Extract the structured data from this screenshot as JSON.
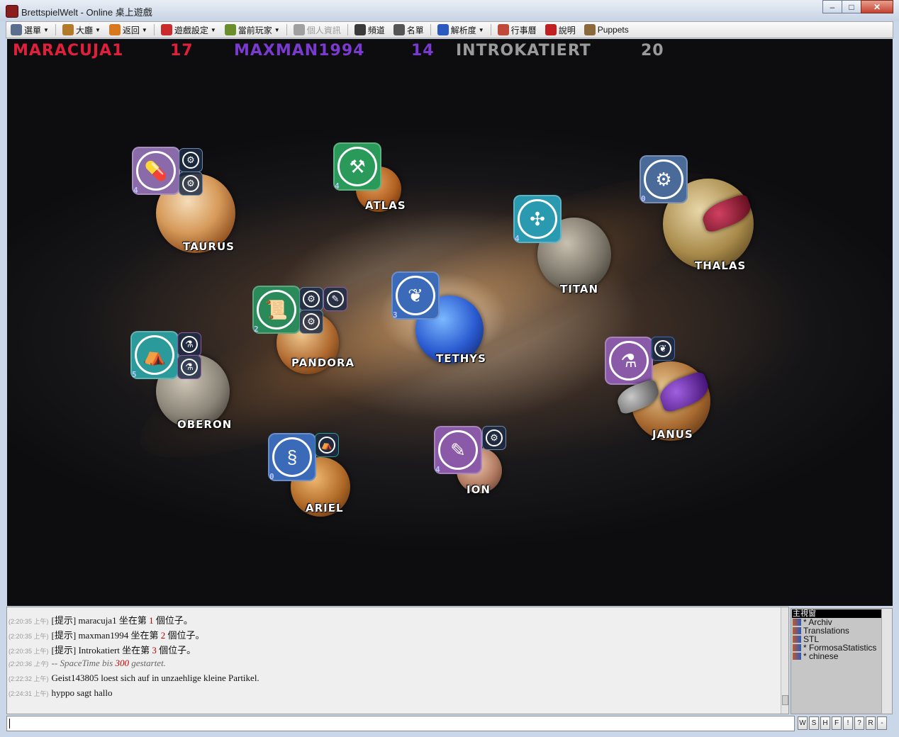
{
  "window": {
    "title": "BrettspielWelt - Online 桌上遊戲",
    "min": "–",
    "max": "□",
    "close": "✕"
  },
  "toolbar": [
    {
      "id": "menu",
      "label": "選單",
      "dropdown": true,
      "icon": "menu-icon",
      "color": "#5a6f8e"
    },
    {
      "id": "lobby",
      "label": "大廳",
      "dropdown": true,
      "icon": "lobby-icon",
      "color": "#b27a2a"
    },
    {
      "id": "back",
      "label": "返回",
      "dropdown": true,
      "icon": "back-icon",
      "color": "#d6791f"
    },
    {
      "id": "game-settings",
      "label": "遊戲設定",
      "dropdown": true,
      "icon": "settings-icon",
      "color": "#c92a2a"
    },
    {
      "id": "current-players",
      "label": "當前玩家",
      "dropdown": true,
      "icon": "players-icon",
      "color": "#6a8f2a"
    },
    {
      "id": "personal-info",
      "label": "個人資訊",
      "dropdown": false,
      "disabled": true,
      "icon": "info-icon",
      "color": "#a0a0a0"
    },
    {
      "id": "channel",
      "label": "頻道",
      "dropdown": false,
      "icon": "channel-icon",
      "color": "#3a3a3a"
    },
    {
      "id": "roster",
      "label": "名單",
      "dropdown": false,
      "icon": "roster-icon",
      "color": "#555"
    },
    {
      "id": "resolution",
      "label": "解析度",
      "dropdown": true,
      "icon": "monitor-icon",
      "color": "#2a5ac0"
    },
    {
      "id": "calendar",
      "label": "行事曆",
      "dropdown": false,
      "icon": "calendar-icon",
      "color": "#c04a3a"
    },
    {
      "id": "help",
      "label": "說明",
      "dropdown": false,
      "icon": "help-icon",
      "color": "#c02020"
    },
    {
      "id": "puppets",
      "label": "Puppets",
      "dropdown": false,
      "icon": "puppet-icon",
      "color": "#8a6a3a"
    }
  ],
  "players": [
    {
      "name": "MARACUJA1",
      "score": "17",
      "color": "#e0203a"
    },
    {
      "name": "MAXMAN1994",
      "score": "14",
      "color": "#7a3ad0"
    },
    {
      "name": "INTROKATIERT",
      "score": "20",
      "color": "#9a9a9a"
    }
  ],
  "planets": [
    {
      "name": "TAURUS",
      "tile": {
        "icon": "capsule-icon",
        "glyph": "💊",
        "num": "4",
        "color": "#8a6aa8"
      },
      "minis": [
        {
          "icon": "gear-icon",
          "glyph": "⚙",
          "color": "#6a8aa8"
        },
        {
          "icon": "gear-icon",
          "glyph": "⚙",
          "color": "#6a8aa8"
        }
      ]
    },
    {
      "name": "ATLAS",
      "tile": {
        "icon": "tools-icon",
        "glyph": "⚒",
        "num": "4",
        "color": "#2a9a5a"
      },
      "minis": []
    },
    {
      "name": "TITAN",
      "tile": {
        "icon": "molecule-icon",
        "glyph": "✣",
        "num": "4",
        "color": "#2a9ab0"
      },
      "minis": []
    },
    {
      "name": "THALAS",
      "tile": {
        "icon": "gear-icon",
        "glyph": "⚙",
        "num": "0",
        "color": "#4a6a9a"
      },
      "minis": []
    },
    {
      "name": "PANDORA",
      "tile": {
        "icon": "scroll-icon",
        "glyph": "📜",
        "num": "2",
        "color": "#2a8a5a"
      },
      "minis": [
        {
          "icon": "gear-icon",
          "glyph": "⚙",
          "color": "#6a8aa8"
        },
        {
          "icon": "syringe-icon",
          "glyph": "✎",
          "color": "#8a5aa8"
        },
        {
          "icon": "gear-icon",
          "glyph": "⚙",
          "color": "#6a8aa8"
        }
      ]
    },
    {
      "name": "TETHYS",
      "tile": {
        "icon": "leaf-icon",
        "glyph": "❦",
        "num": "3",
        "color": "#3a6ab8"
      },
      "minis": []
    },
    {
      "name": "OBERON",
      "tile": {
        "icon": "sofa-icon",
        "glyph": "⛺",
        "num": "5",
        "color": "#2a9a9a"
      },
      "minis": [
        {
          "icon": "flask-icon",
          "glyph": "⚗",
          "color": "#8a5aa8"
        },
        {
          "icon": "flask-icon",
          "glyph": "⚗",
          "color": "#8a5aa8"
        }
      ]
    },
    {
      "name": "JANUS",
      "tile": {
        "icon": "flask-icon",
        "glyph": "⚗",
        "num": "",
        "color": "#8a5aa8"
      },
      "minis": [
        {
          "icon": "leaf-icon",
          "glyph": "❦",
          "color": "#3a6ab8"
        }
      ]
    },
    {
      "name": "ARIEL",
      "tile": {
        "icon": "dna-icon",
        "glyph": "§",
        "num": "0",
        "color": "#3a6ab8"
      },
      "minis": [
        {
          "icon": "sofa-icon",
          "glyph": "⛺",
          "color": "#2a9a9a"
        }
      ]
    },
    {
      "name": "ION",
      "tile": {
        "icon": "syringe-icon",
        "glyph": "✎",
        "num": "4",
        "color": "#8a5aa8"
      },
      "minis": [
        {
          "icon": "gear-icon",
          "glyph": "⚙",
          "color": "#6a8aa8"
        }
      ]
    }
  ],
  "chat": [
    {
      "ts": "(2:20:35 上午)",
      "parts": [
        "[提示] maracuja1 坐在第 ",
        "1",
        " 個位子。"
      ]
    },
    {
      "ts": "(2:20:35 上午)",
      "parts": [
        "[提示] maxman1994 坐在第 ",
        "2",
        " 個位子。"
      ]
    },
    {
      "ts": "(2:20:35 上午)",
      "parts": [
        "[提示] Introkatiert 坐在第 ",
        "3",
        " 個位子。"
      ]
    },
    {
      "ts": "(2:20:36 上午)",
      "parts": [
        "-- SpaceTime bis ",
        "300",
        " gestartet."
      ],
      "italic": true
    },
    {
      "ts": "(2:22:32 上午)",
      "parts": [
        "Geist143805 loest sich auf in unzaehlige kleine Partikel.",
        "",
        ""
      ]
    },
    {
      "ts": "(2:24:31 上午)",
      "parts": [
        "hyppo sagt hallo",
        "",
        ""
      ]
    }
  ],
  "channels": {
    "header": "主視窗",
    "items": [
      "* Archiv",
      "Translations",
      "STL",
      "* FormosaStatistics",
      "* chinese"
    ]
  },
  "buttons": [
    "W",
    "S",
    "H",
    "F",
    "!",
    "?",
    "R",
    "-"
  ]
}
